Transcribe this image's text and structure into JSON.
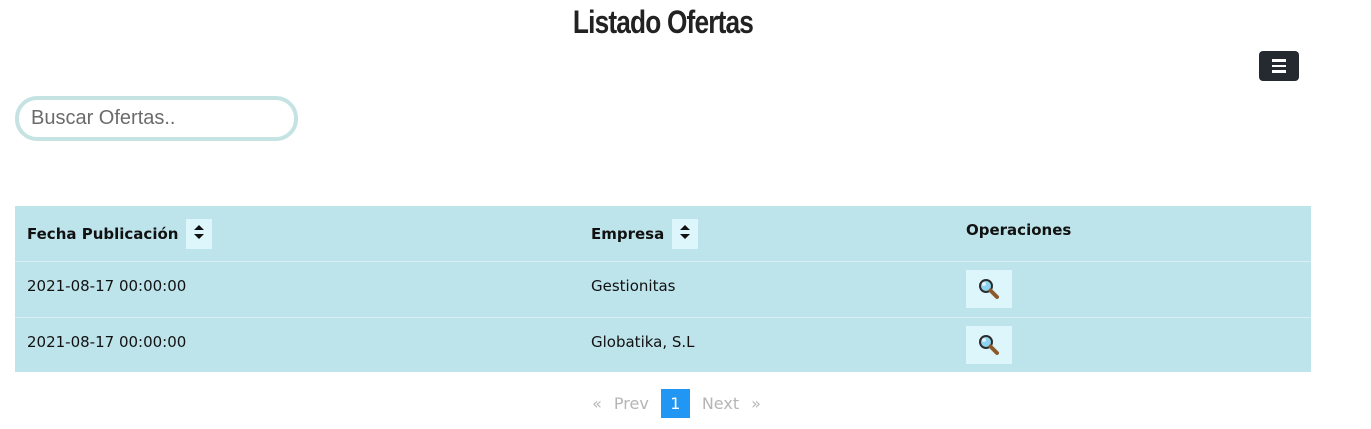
{
  "header": {
    "title": "Listado Ofertas",
    "menu_icon": "bars-icon"
  },
  "search": {
    "placeholder": "Buscar Ofertas..",
    "value": ""
  },
  "table": {
    "columns": [
      "Fecha Publicación",
      "Empresa",
      "Operaciones"
    ],
    "sort_icon": "sort-icon",
    "view_icon": "magnifier-icon",
    "rows": [
      {
        "fecha": "2021-08-17 00:00:00",
        "empresa": "Gestionitas"
      },
      {
        "fecha": "2021-08-17 00:00:00",
        "empresa": "Globatika, S.L"
      }
    ]
  },
  "pagination": {
    "first": "«",
    "prev": "Prev",
    "current": "1",
    "next": "Next",
    "last": "»"
  },
  "colors": {
    "table_background": "#bee4eb",
    "button_background": "#ddf6fb",
    "active_page": "#2196f3",
    "menu_button": "#252a30",
    "search_border": "#c5e3e3"
  }
}
